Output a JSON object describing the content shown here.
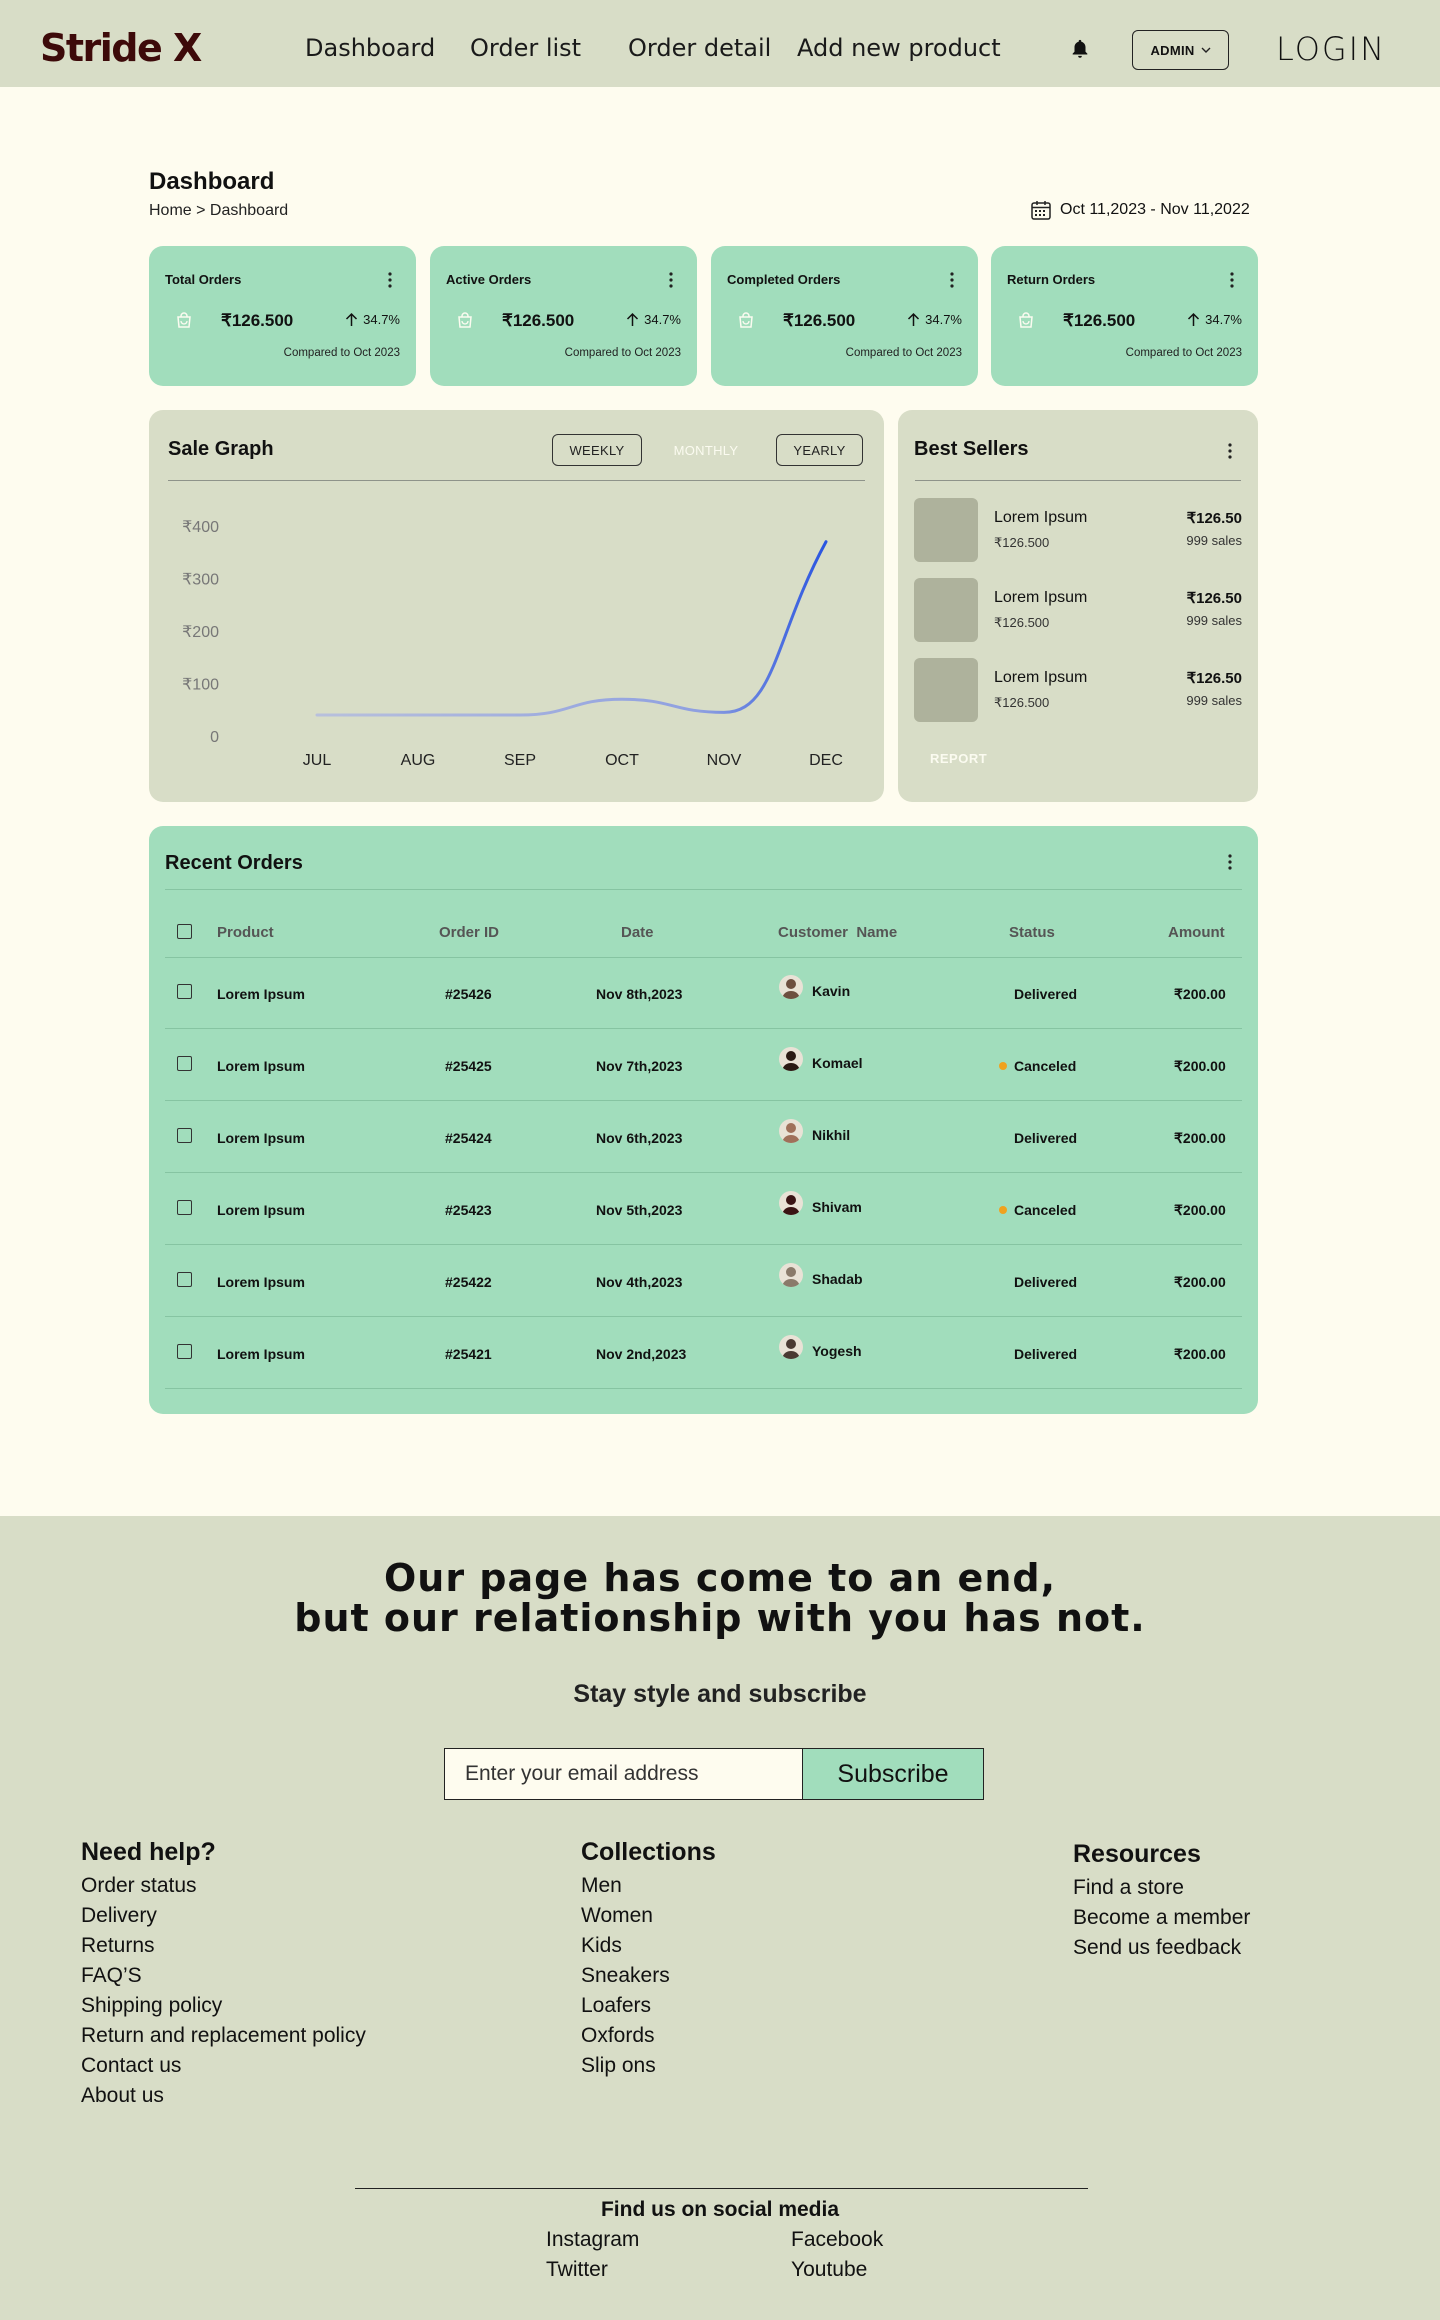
{
  "brand": {
    "logo": "Stride X"
  },
  "nav": {
    "links": [
      "Dashboard",
      "Order list",
      "Order detail",
      "Add new product"
    ],
    "admin_label": "ADMIN",
    "login_label": "LOGIN"
  },
  "header": {
    "title": "Dashboard",
    "breadcrumb": "Home > Dashboard",
    "date_range": "Oct 11,2023 - Nov 11,2022"
  },
  "stats": [
    {
      "title": "Total Orders",
      "value": "₹126.500",
      "change": "34.7%",
      "compare": "Compared to Oct 2023"
    },
    {
      "title": "Active Orders",
      "value": "₹126.500",
      "change": "34.7%",
      "compare": "Compared to Oct 2023"
    },
    {
      "title": "Completed Orders",
      "value": "₹126.500",
      "change": "34.7%",
      "compare": "Compared to Oct 2023"
    },
    {
      "title": "Return Orders",
      "value": "₹126.500",
      "change": "34.7%",
      "compare": "Compared to Oct 2023"
    }
  ],
  "sale_graph": {
    "title": "Sale Graph",
    "tabs": [
      "WEEKLY",
      "MONTHLY",
      "YEARLY"
    ]
  },
  "chart_data": {
    "type": "line",
    "title": "Sale Graph",
    "x": [
      "JUL",
      "AUG",
      "SEP",
      "OCT",
      "NOV",
      "DEC"
    ],
    "y_ticks": [
      "0",
      "₹100",
      "₹200",
      "₹300",
      "₹400"
    ],
    "ylim": [
      0,
      400
    ],
    "series": [
      {
        "values": [
          40,
          40,
          40,
          70,
          45,
          370
        ]
      }
    ],
    "grid": false,
    "colors": {
      "line_start": "#b8c0dc",
      "line_end": "#2a55e0"
    }
  },
  "best_sellers": {
    "title": "Best Sellers",
    "items": [
      {
        "name": "Lorem Ipsum",
        "sub": "₹126.500",
        "price": "₹126.50",
        "sales": "999 sales"
      },
      {
        "name": "Lorem Ipsum",
        "sub": "₹126.500",
        "price": "₹126.50",
        "sales": "999 sales"
      },
      {
        "name": "Lorem Ipsum",
        "sub": "₹126.500",
        "price": "₹126.50",
        "sales": "999 sales"
      }
    ],
    "report_label": "REPORT"
  },
  "recent_orders": {
    "title": "Recent Orders",
    "columns": [
      "Product",
      "Order ID",
      "Date",
      "Customer  Name",
      "Status",
      "Amount"
    ],
    "rows": [
      {
        "product": "Lorem Ipsum",
        "id": "#25426",
        "date": "Nov 8th,2023",
        "customer": "Kavin",
        "status": "Delivered",
        "amount": "₹200.00"
      },
      {
        "product": "Lorem Ipsum",
        "id": "#25425",
        "date": "Nov 7th,2023",
        "customer": "Komael",
        "status": "Canceled",
        "amount": "₹200.00"
      },
      {
        "product": "Lorem Ipsum",
        "id": "#25424",
        "date": "Nov 6th,2023",
        "customer": "Nikhil",
        "status": "Delivered",
        "amount": "₹200.00"
      },
      {
        "product": "Lorem Ipsum",
        "id": "#25423",
        "date": "Nov 5th,2023",
        "customer": "Shivam",
        "status": "Canceled",
        "amount": "₹200.00"
      },
      {
        "product": "Lorem Ipsum",
        "id": "#25422",
        "date": "Nov 4th,2023",
        "customer": "Shadab",
        "status": "Delivered",
        "amount": "₹200.00"
      },
      {
        "product": "Lorem Ipsum",
        "id": "#25421",
        "date": "Nov 2nd,2023",
        "customer": "Yogesh",
        "status": "Delivered",
        "amount": "₹200.00"
      }
    ]
  },
  "footer": {
    "headline_1": "Our page has come to an end,",
    "headline_2": "but our relationship with you has not.",
    "subscribe_heading": "Stay style and subscribe",
    "email_placeholder": "Enter your email address",
    "subscribe_label": "Subscribe",
    "need_help": {
      "title": "Need help?",
      "links": [
        "Order status",
        "Delivery",
        "Returns",
        "FAQ’S",
        "Shipping policy",
        "Return and replacement policy",
        "Contact us",
        "About us"
      ]
    },
    "collections": {
      "title": "Collections",
      "links": [
        "Men",
        "Women",
        "Kids",
        "Sneakers",
        "Loafers",
        "Oxfords",
        "Slip ons"
      ]
    },
    "resources": {
      "title": "Resources",
      "links": [
        "Find a store",
        "Become a member",
        "Send us feedback"
      ]
    },
    "social": {
      "title": "Find us on social media",
      "links": [
        "Instagram",
        "Facebook",
        "Twitter",
        "Youtube"
      ]
    }
  },
  "colors": {
    "nav_bg": "#d8ddc7",
    "page_bg": "#fefcef",
    "card_green": "#a1ddbc",
    "logo": "#3d0a0a",
    "status_canceled": "#f0a21e"
  }
}
